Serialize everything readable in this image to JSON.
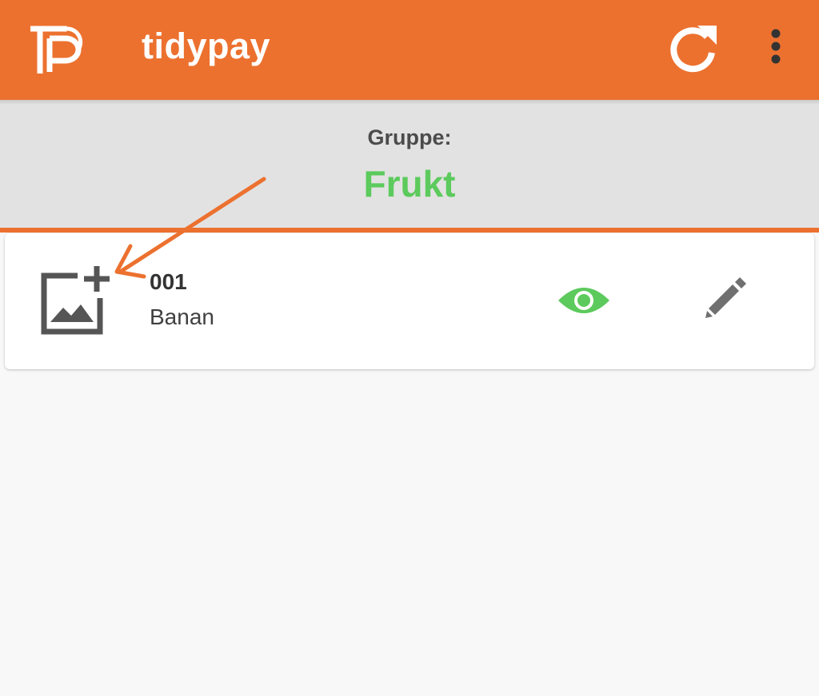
{
  "appbar": {
    "title": "tidypay",
    "logo_icon": "tidypay-logo-icon",
    "refresh_icon": "refresh-icon",
    "menu_icon": "more-vert-icon",
    "background_color": "#ec712f"
  },
  "group": {
    "label": "Gruppe:",
    "name": "Frukt",
    "name_color": "#5cca5c"
  },
  "items": [
    {
      "number": "001",
      "name": "Banan",
      "image_icon": "add-image-icon",
      "view_icon": "eye-icon",
      "edit_icon": "pencil-icon"
    }
  ],
  "colors": {
    "accent": "#ec712f",
    "positive": "#5cca5c",
    "icon_gray": "#555555"
  }
}
